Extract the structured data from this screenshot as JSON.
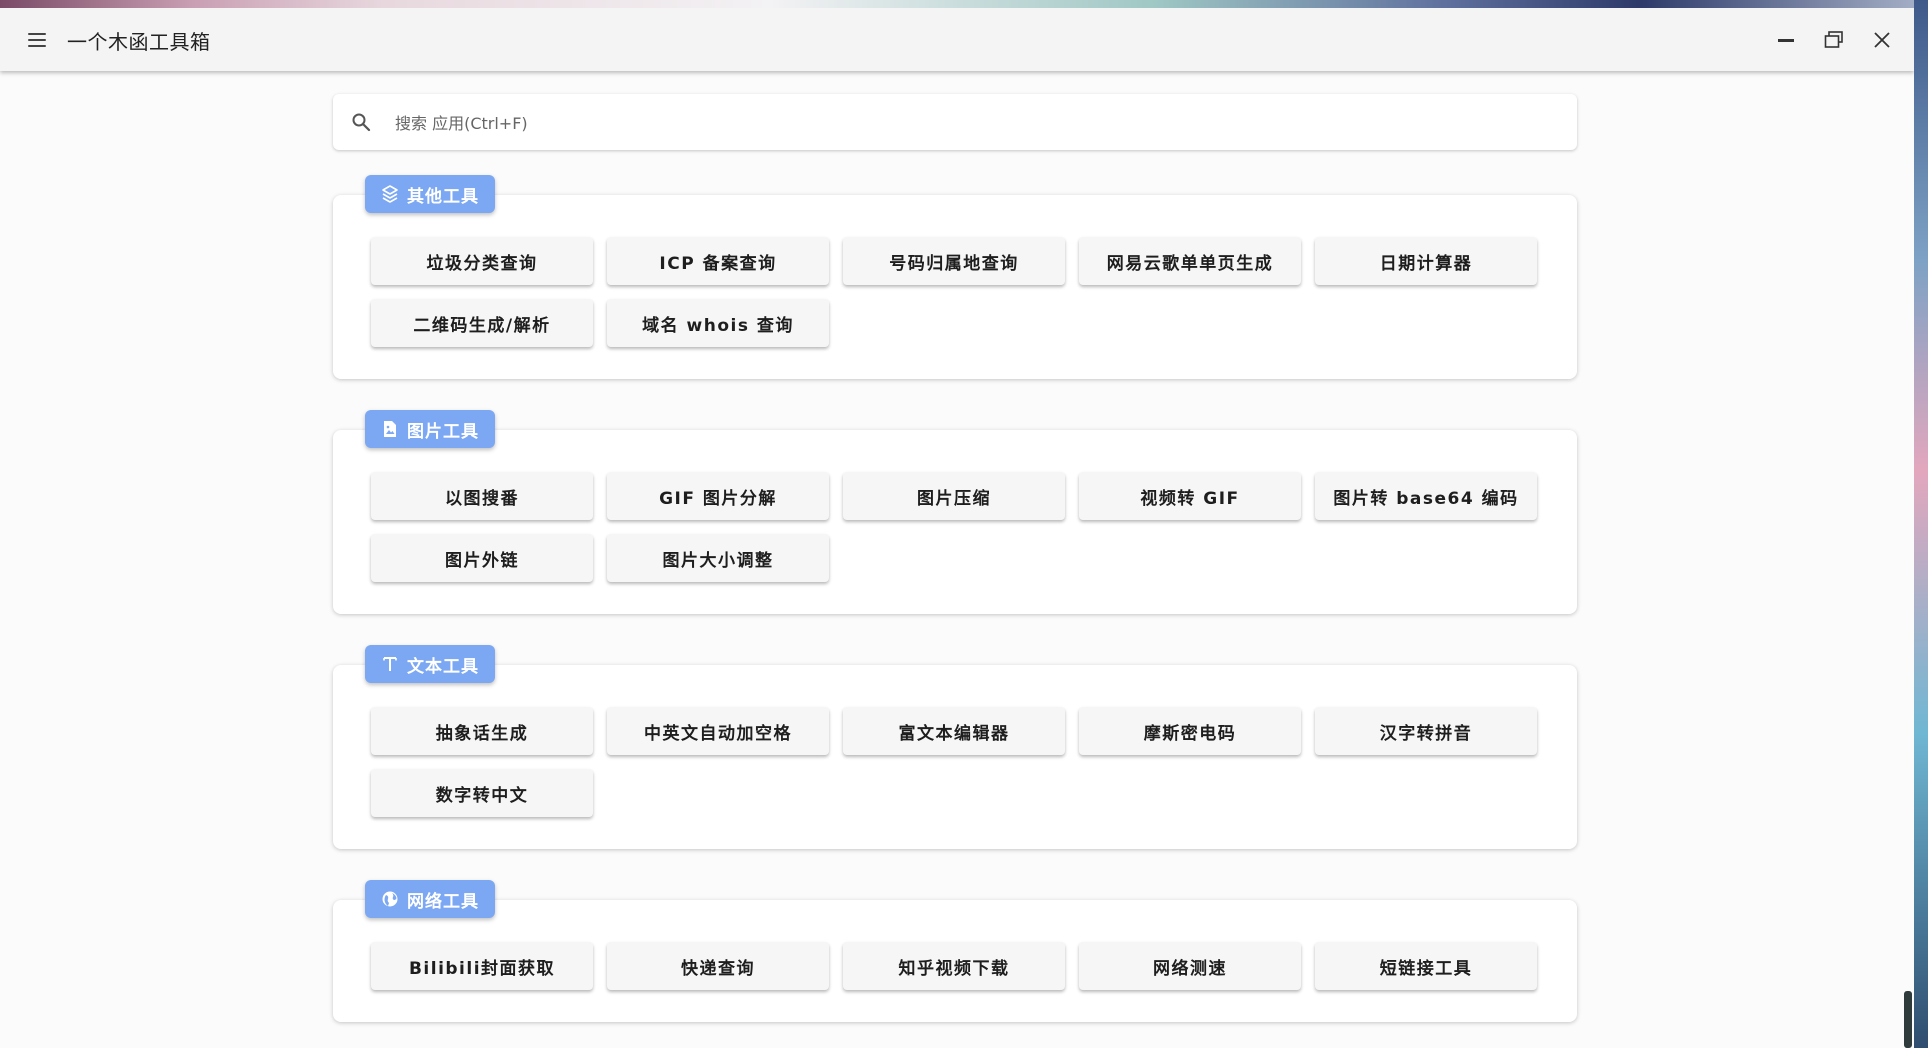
{
  "app": {
    "title": "一个木函工具箱"
  },
  "window_controls": {
    "minimize_icon": "minimize-icon",
    "maximize_icon": "maximize-icon",
    "close_icon": "close-icon"
  },
  "search": {
    "placeholder": "搜索 应用(Ctrl+F)",
    "value": ""
  },
  "colors": {
    "accent": "#7ba7f3",
    "button_bg": "#f6f6f6",
    "background": "#fbfbfb"
  },
  "sections": [
    {
      "title": "其他工具",
      "icon": "layers-icon",
      "tools": [
        "垃圾分类查询",
        "ICP 备案查询",
        "号码归属地查询",
        "网易云歌单单页生成",
        "日期计算器",
        "二维码生成/解析",
        "域名 whois 查询"
      ]
    },
    {
      "title": "图片工具",
      "icon": "image-file-icon",
      "tools": [
        "以图搜番",
        "GIF 图片分解",
        "图片压缩",
        "视频转 GIF",
        "图片转 base64 编码",
        "图片外链",
        "图片大小调整"
      ]
    },
    {
      "title": "文本工具",
      "icon": "text-icon",
      "tools": [
        "抽象话生成",
        "中英文自动加空格",
        "富文本编辑器",
        "摩斯密电码",
        "汉字转拼音",
        "数字转中文"
      ]
    },
    {
      "title": "网络工具",
      "icon": "globe-icon",
      "tools": [
        "Bilibili封面获取",
        "快递查询",
        "知乎视频下载",
        "网络测速",
        "短链接工具"
      ]
    }
  ]
}
